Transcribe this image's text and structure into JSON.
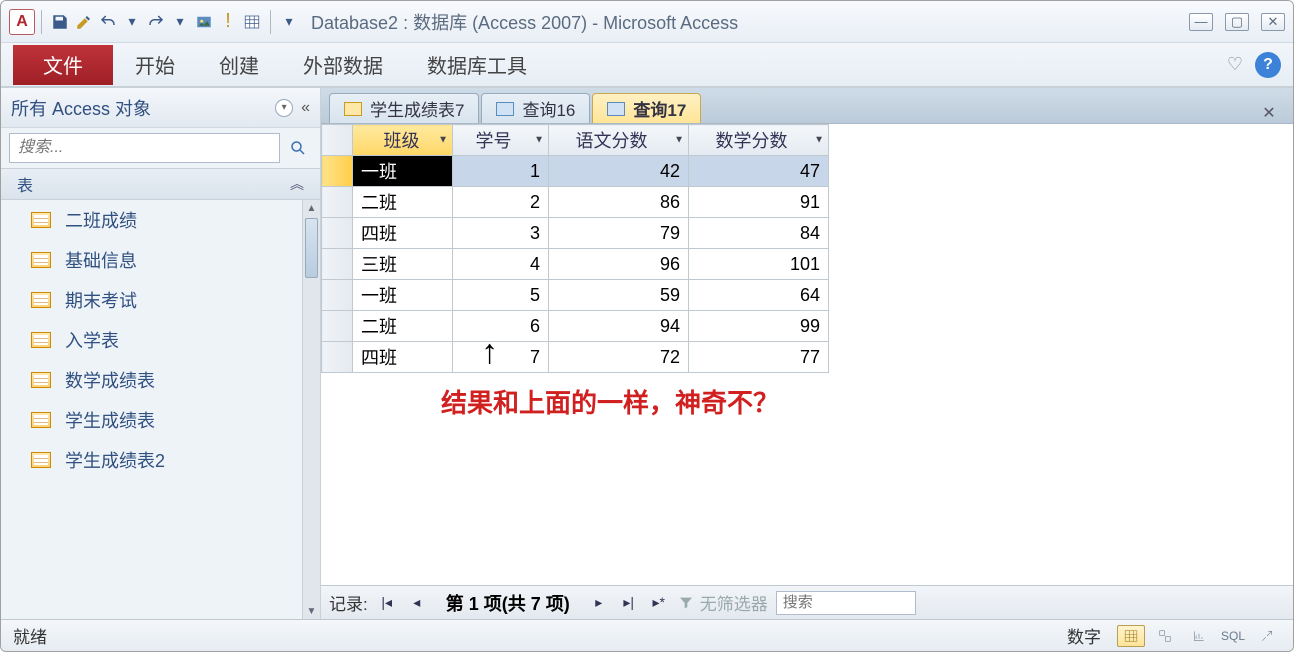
{
  "title": "Database2 : 数据库 (Access 2007) - Microsoft Access",
  "app_letter": "A",
  "ribbon": {
    "file": "文件",
    "tabs": [
      "开始",
      "创建",
      "外部数据",
      "数据库工具"
    ]
  },
  "nav": {
    "title": "所有 Access 对象",
    "search_placeholder": "搜索...",
    "group": "表",
    "items": [
      "二班成绩",
      "基础信息",
      "期末考试",
      "入学表",
      "数学成绩表",
      "学生成绩表",
      "学生成绩表2"
    ]
  },
  "doc_tabs": [
    {
      "label": "学生成绩表7",
      "kind": "table",
      "active": false
    },
    {
      "label": "查询16",
      "kind": "query",
      "active": false
    },
    {
      "label": "查询17",
      "kind": "query",
      "active": true
    }
  ],
  "grid": {
    "columns": [
      "班级",
      "学号",
      "语文分数",
      "数学分数"
    ],
    "rows": [
      {
        "班级": "一班",
        "学号": 1,
        "语文分数": 42,
        "数学分数": 47,
        "selected": true
      },
      {
        "班级": "二班",
        "学号": 2,
        "语文分数": 86,
        "数学分数": 91
      },
      {
        "班级": "四班",
        "学号": 3,
        "语文分数": 79,
        "数学分数": 84
      },
      {
        "班级": "三班",
        "学号": 4,
        "语文分数": 96,
        "数学分数": 101
      },
      {
        "班级": "一班",
        "学号": 5,
        "语文分数": 59,
        "数学分数": 64
      },
      {
        "班级": "二班",
        "学号": 6,
        "语文分数": 94,
        "数学分数": 99
      },
      {
        "班级": "四班",
        "学号": 7,
        "语文分数": 72,
        "数学分数": 77
      }
    ]
  },
  "annotation": "结果和上面的一样，神奇不？",
  "record_nav": {
    "label": "记录:",
    "position": "第 1 项(共 7 项)",
    "no_filter": "无筛选器",
    "search_placeholder": "搜索"
  },
  "status": {
    "left": "就绪",
    "right": "数字",
    "sql": "SQL"
  }
}
